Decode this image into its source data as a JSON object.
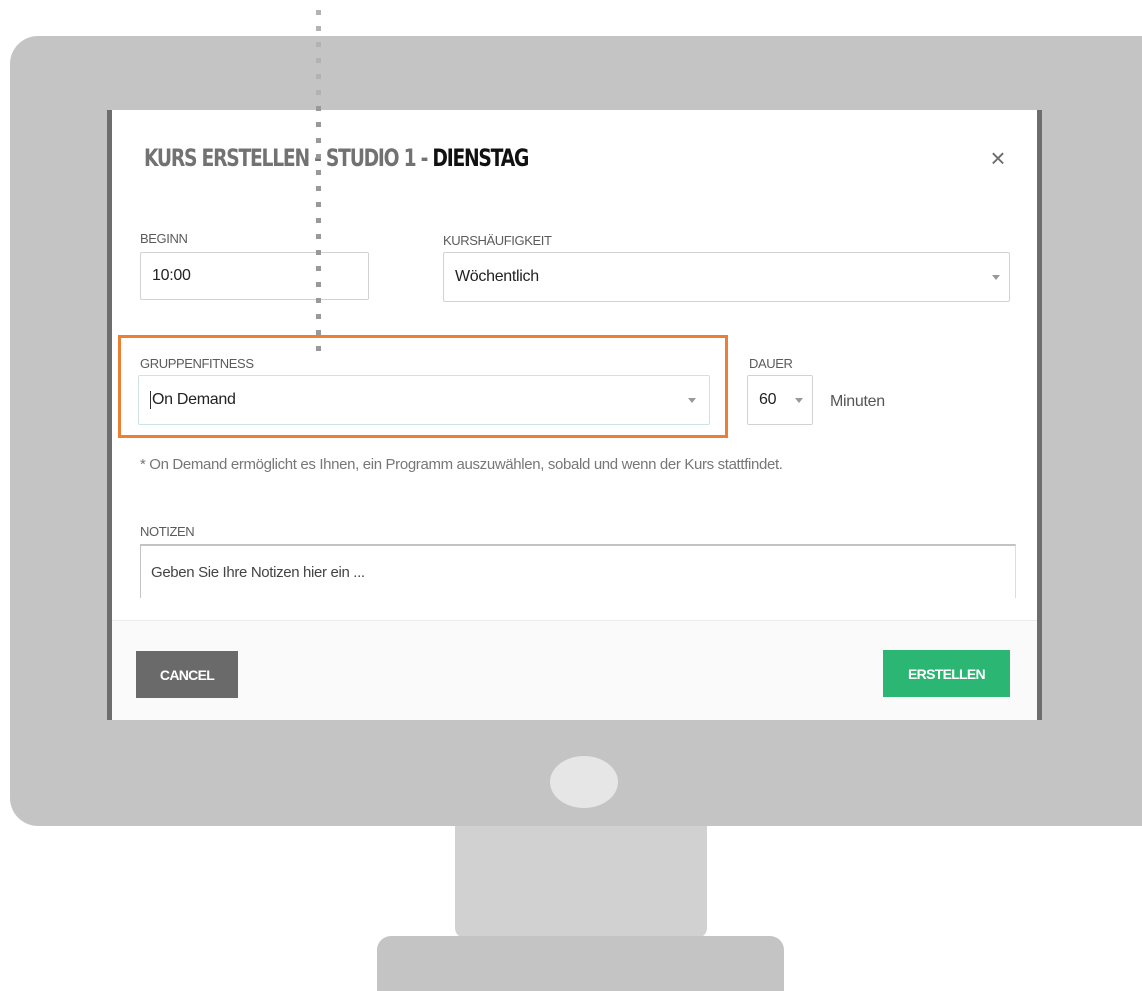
{
  "dialog": {
    "title_prefix": "KURS ERSTELLEN - STUDIO 1 - ",
    "title_day": "DIENSTAG",
    "close_label": "×"
  },
  "form": {
    "begin": {
      "label": "BEGINN",
      "value": "10:00"
    },
    "frequency": {
      "label": "KURSHÄUFIGKEIT",
      "value": "Wöchentlich"
    },
    "group_fitness": {
      "label": "GRUPPENFITNESS",
      "value": "On Demand"
    },
    "duration": {
      "label": "DAUER",
      "value": "60",
      "unit": "Minuten"
    },
    "hint": "* On Demand ermöglicht es Ihnen, ein Programm auszuwählen, sobald und wenn der Kurs stattfindet.",
    "notes": {
      "label": "NOTIZEN",
      "placeholder": "Geben Sie Ihre Notizen hier ein ..."
    }
  },
  "footer": {
    "cancel_label": "CANCEL",
    "create_label": "ERSTELLEN"
  },
  "colors": {
    "highlight": "#ec7f34",
    "create_button": "#2bb673",
    "cancel_button": "#6a6a6a"
  }
}
